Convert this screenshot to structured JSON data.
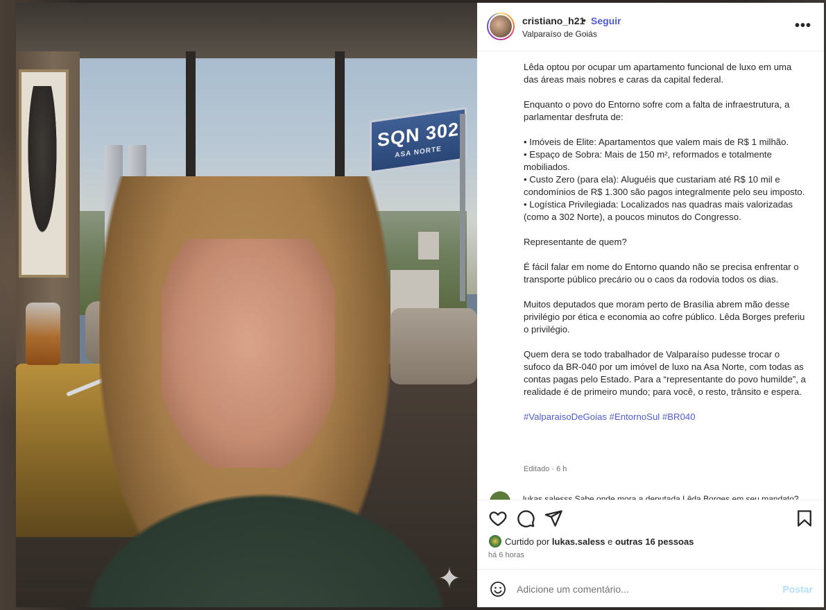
{
  "post": {
    "username": "cristiano_h21",
    "separator": "•",
    "follow_label": "Seguir",
    "location": "Valparaíso de Goiás",
    "more_icon": "more-horizontal-icon",
    "more_label": "•••"
  },
  "media": {
    "sign_main": "SQN 302",
    "sign_sub": "ASA NORTE",
    "sparkle": "✦"
  },
  "caption": {
    "paragraphs": [
      "Lêda optou por ocupar um apartamento funcional de luxo em uma das áreas mais nobres e caras da capital federal.",
      "Enquanto o povo do Entorno sofre com a falta de infraestrutura, a parlamentar desfruta de:",
      "• Imóveis de Elite: Apartamentos que valem mais de R$ 1 milhão.\n• Espaço de Sobra: Mais de 150 m², reformados e totalmente mobiliados.\n• Custo Zero (para ela): Aluguéis que custariam até R$ 10 mil e condomínios de R$ 1.300 são pagos integralmente pelo seu imposto.\n• Logística Privilegiada: Localizados nas quadras mais valorizadas (como a 302 Norte), a poucos minutos do Congresso.",
      "Representante de quem?",
      "É fácil falar em nome do Entorno quando não se precisa enfrentar o transporte público precário ou o caos da rodovia todos os dias.",
      "Muitos deputados que moram perto de Brasília abrem mão desse privilégio por ética e economia ao cofre público. Lêda Borges preferiu o privilégio.",
      "Quem dera se todo trabalhador de Valparaíso pudesse trocar o sufoco da BR-040 por um imóvel de luxo na Asa Norte, com todas as contas pagas pelo Estado. Para a “representante do povo humilde”, a realidade é de primeiro mundo; para você, o resto, trânsito e espera."
    ],
    "hashtags": [
      "#ValparaisoDeGoias",
      "#EntornoSul",
      "#BR040"
    ],
    "edited": "Editado · 6 h"
  },
  "comment_peek": "lukas.salesss Sabe onde mora a deputada Lêda Borges em seu mandato?",
  "actions": {
    "like_icon": "heart-icon",
    "comment_icon": "comment-icon",
    "share_icon": "send-icon",
    "save_icon": "bookmark-icon"
  },
  "likes": {
    "prefix": "Curtido por ",
    "user": "lukas.saless",
    "middle": " e ",
    "others": "outras 16 pessoas"
  },
  "time": "há 6 horas",
  "comment_box": {
    "placeholder": "Adicione um comentário...",
    "post_label": "Postar",
    "emoji_icon": "smile-icon"
  }
}
